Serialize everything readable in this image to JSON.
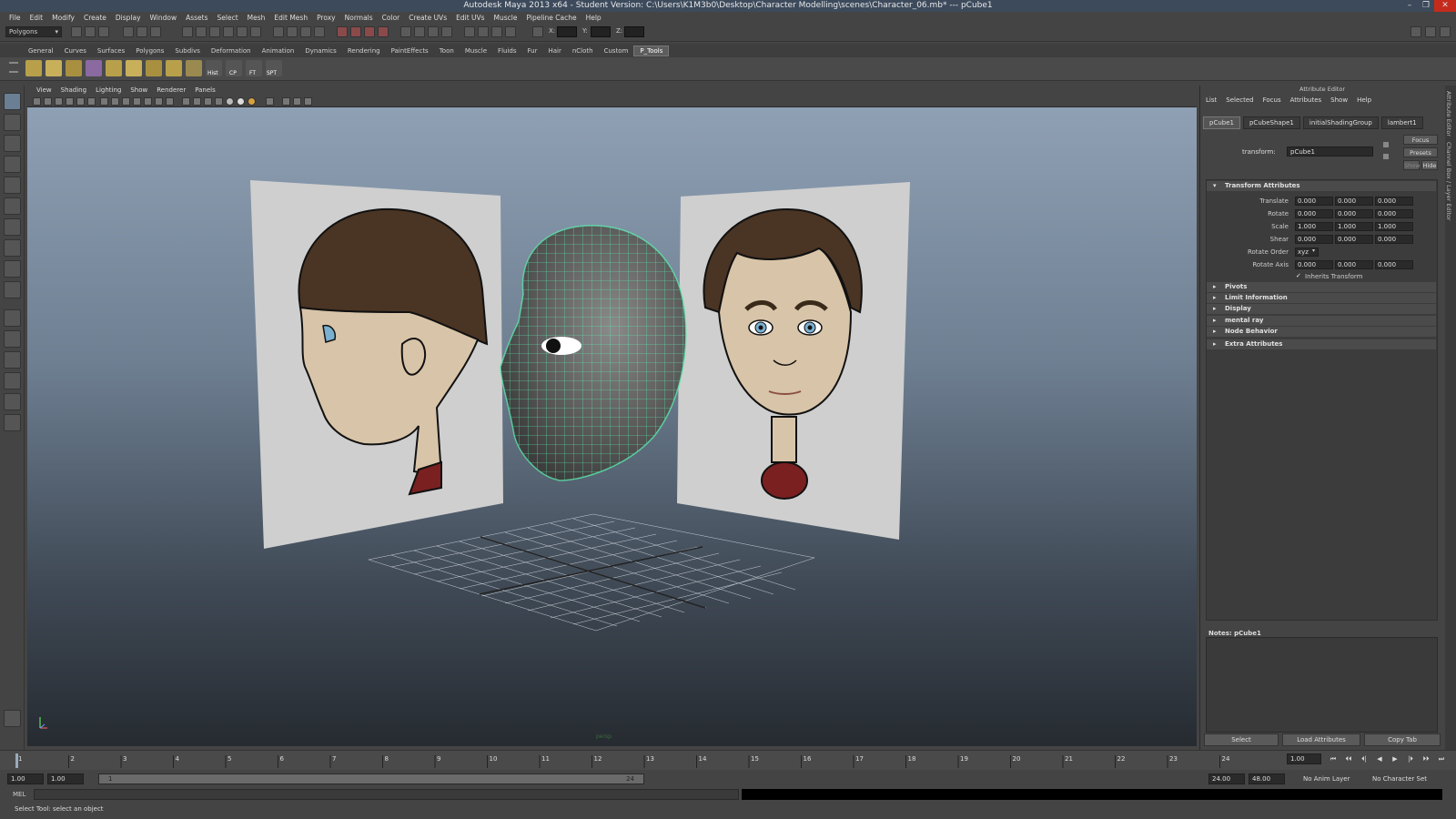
{
  "window": {
    "title": "Autodesk Maya 2013 x64 - Student Version: C:\\Users\\K1M3b0\\Desktop\\Character Modelling\\scenes\\Character_06.mb*   ---   pCube1",
    "minimize": "–",
    "restore": "❐",
    "close": "✕"
  },
  "menubar": [
    "File",
    "Edit",
    "Modify",
    "Create",
    "Display",
    "Window",
    "Assets",
    "Select",
    "Mesh",
    "Edit Mesh",
    "Proxy",
    "Normals",
    "Color",
    "Create UVs",
    "Edit UVs",
    "Muscle",
    "Pipeline Cache",
    "Help"
  ],
  "statusline": {
    "mode": "Polygons",
    "x_label": "X:",
    "y_label": "Y:",
    "z_label": "Z:"
  },
  "shelf": {
    "tabs": [
      "General",
      "Curves",
      "Surfaces",
      "Polygons",
      "Subdivs",
      "Deformation",
      "Animation",
      "Dynamics",
      "Rendering",
      "PaintEffects",
      "Toon",
      "Muscle",
      "Fluids",
      "Fur",
      "Hair",
      "nCloth",
      "Custom",
      "P_Tools"
    ],
    "active_tab": "P_Tools",
    "labels": [
      "Hist",
      "CP",
      "FT",
      "SPT"
    ]
  },
  "viewport": {
    "menus": [
      "View",
      "Shading",
      "Lighting",
      "Show",
      "Renderer",
      "Panels"
    ],
    "camera_label": "persp"
  },
  "attribute_editor": {
    "title": "Attribute Editor",
    "menus": [
      "List",
      "Selected",
      "Focus",
      "Attributes",
      "Show",
      "Help"
    ],
    "tabs": [
      "pCube1",
      "pCubeShape1",
      "initialShadingGroup",
      "lambert1"
    ],
    "transform_label": "transform:",
    "transform_value": "pCube1",
    "buttons": {
      "focus": "Focus",
      "presets": "Presets",
      "show": "Show",
      "hide": "Hide"
    },
    "sections": {
      "transform": "Transform Attributes",
      "pivots": "Pivots",
      "limit": "Limit Information",
      "display": "Display",
      "mental_ray": "mental ray",
      "node_behavior": "Node Behavior",
      "extra": "Extra Attributes"
    },
    "attrs": {
      "translate": {
        "label": "Translate",
        "x": "0.000",
        "y": "0.000",
        "z": "0.000"
      },
      "rotate": {
        "label": "Rotate",
        "x": "0.000",
        "y": "0.000",
        "z": "0.000"
      },
      "scale": {
        "label": "Scale",
        "x": "1.000",
        "y": "1.000",
        "z": "1.000"
      },
      "shear": {
        "label": "Shear",
        "x": "0.000",
        "y": "0.000",
        "z": "0.000"
      },
      "rotate_order": {
        "label": "Rotate Order",
        "value": "xyz"
      },
      "rotate_axis": {
        "label": "Rotate Axis",
        "x": "0.000",
        "y": "0.000",
        "z": "0.000"
      },
      "inherits": "Inherits Transform"
    },
    "notes_label": "Notes:  pCube1",
    "bottom_buttons": {
      "select": "Select",
      "load": "Load Attributes",
      "copy": "Copy Tab"
    },
    "side_tabs": [
      "Attribute Editor",
      "Channel Box / Layer Editor"
    ]
  },
  "timeline": {
    "ticks": [
      "1",
      "2",
      "3",
      "4",
      "5",
      "6",
      "7",
      "8",
      "9",
      "10",
      "11",
      "12",
      "13",
      "14",
      "15",
      "16",
      "17",
      "18",
      "19",
      "20",
      "21",
      "22",
      "23",
      "24"
    ],
    "current_time": "1.00",
    "range_start": "1.00",
    "playback_start": "1.00",
    "range_bar_lo": "1",
    "range_bar_hi": "24",
    "playback_end": "24.00",
    "range_end": "48.00",
    "anim_layer": "No Anim Layer",
    "character_set": "No Character Set",
    "playback_buttons": [
      "⏮",
      "⏴⏴",
      "⏴|",
      "◀",
      "▶",
      "|⏵",
      "⏵⏵",
      "⏭"
    ]
  },
  "command_line": {
    "label": "MEL"
  },
  "help_line": "Select Tool: select an object",
  "colors": {
    "accent": "#6b7f94",
    "wire": "#5cf0b0",
    "hair": "#4a3424",
    "skin": "#d8c4a8"
  }
}
